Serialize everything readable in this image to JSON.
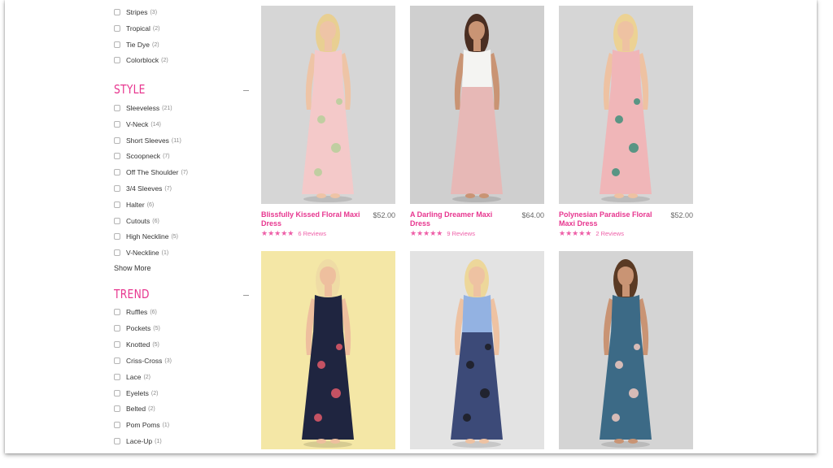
{
  "filters": {
    "pattern_options": [
      {
        "label": "Stripes",
        "count": "(3)"
      },
      {
        "label": "Tropical",
        "count": "(2)"
      },
      {
        "label": "Tie Dye",
        "count": "(2)"
      },
      {
        "label": "Colorblock",
        "count": "(2)"
      }
    ],
    "style": {
      "title": "STYLE",
      "options": [
        {
          "label": "Sleeveless",
          "count": "(21)"
        },
        {
          "label": "V-Neck",
          "count": "(14)"
        },
        {
          "label": "Short Sleeves",
          "count": "(11)"
        },
        {
          "label": "Scoopneck",
          "count": "(7)"
        },
        {
          "label": "Off The Shoulder",
          "count": "(7)"
        },
        {
          "label": "3/4 Sleeves",
          "count": "(7)"
        },
        {
          "label": "Halter",
          "count": "(6)"
        },
        {
          "label": "Cutouts",
          "count": "(6)"
        },
        {
          "label": "High Neckline",
          "count": "(5)"
        },
        {
          "label": "V-Neckline",
          "count": "(1)"
        }
      ],
      "show_more": "Show More"
    },
    "trend": {
      "title": "TREND",
      "options": [
        {
          "label": "Ruffles",
          "count": "(6)"
        },
        {
          "label": "Pockets",
          "count": "(5)"
        },
        {
          "label": "Knotted",
          "count": "(5)"
        },
        {
          "label": "Criss-Cross",
          "count": "(3)"
        },
        {
          "label": "Lace",
          "count": "(2)"
        },
        {
          "label": "Eyelets",
          "count": "(2)"
        },
        {
          "label": "Belted",
          "count": "(2)"
        },
        {
          "label": "Pom Poms",
          "count": "(1)"
        },
        {
          "label": "Lace-Up",
          "count": "(1)"
        }
      ]
    }
  },
  "products": [
    {
      "name": "Blissfully Kissed Floral Maxi Dress",
      "price": "$52.00",
      "stars": "★★★★★",
      "reviews": "6 Reviews",
      "bg": "#d6d6d6",
      "dress": "#f4c9c9",
      "accent": "#b6cf9a",
      "top": "#f4c9c9",
      "hair": "#e8cf92",
      "skin": "#eec4a6"
    },
    {
      "name": "A Darling Dreamer Maxi Dress",
      "price": "$64.00",
      "stars": "★★★★★",
      "reviews": "9 Reviews",
      "bg": "#cfcfcf",
      "dress": "#e7b8b6",
      "accent": "#e7b8b6",
      "top": "#f4f4f2",
      "hair": "#4a2e22",
      "skin": "#c99474"
    },
    {
      "name": "Polynesian Paradise Floral Maxi Dress",
      "price": "$52.00",
      "stars": "★★★★★",
      "reviews": "2 Reviews",
      "bg": "#d6d6d6",
      "dress": "#f0b6b8",
      "accent": "#3f8f7a",
      "top": "#f0b6b8",
      "hair": "#ecd294",
      "skin": "#eec2a2"
    },
    {
      "name": "",
      "price": "",
      "stars": "",
      "reviews": "",
      "bg": "#f4e7a6",
      "dress": "#1f2540",
      "accent": "#e25a6a",
      "top": "#1f2540",
      "hair": "#efdca5",
      "skin": "#eebf9e"
    },
    {
      "name": "",
      "price": "",
      "stars": "",
      "reviews": "",
      "bg": "#e3e3e3",
      "dress": "#3c4a78",
      "accent": "#1c1c22",
      "top": "#93b2e2",
      "hair": "#edd79a",
      "skin": "#eec2a2"
    },
    {
      "name": "",
      "price": "",
      "stars": "",
      "reviews": "",
      "bg": "#d4d4d4",
      "dress": "#3c6a86",
      "accent": "#f1c9c0",
      "top": "#3c6a86",
      "hair": "#5a3a24",
      "skin": "#c99474"
    }
  ]
}
